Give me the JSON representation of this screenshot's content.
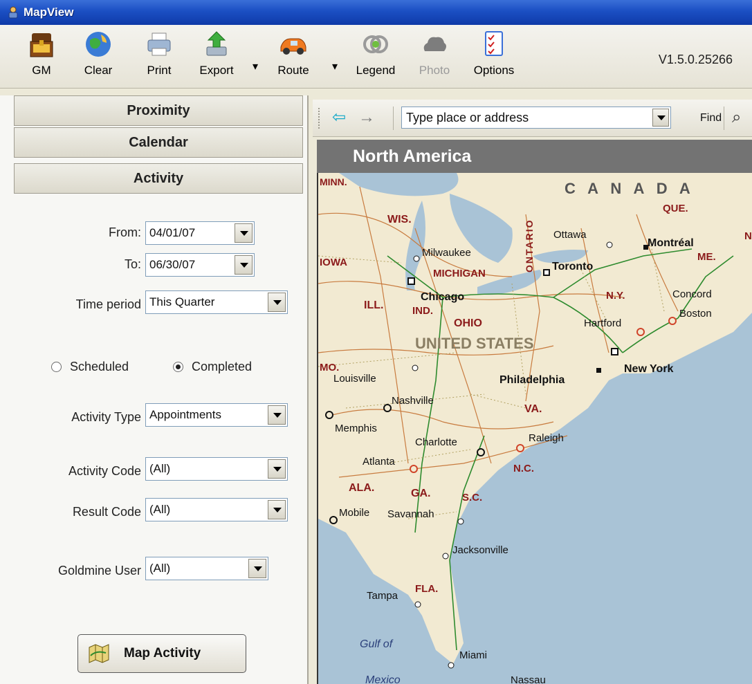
{
  "window": {
    "title": "MapView"
  },
  "toolbar": {
    "buttons": [
      {
        "label": "GM"
      },
      {
        "label": "Clear"
      },
      {
        "label": "Print"
      },
      {
        "label": "Export"
      },
      {
        "label": "Route"
      },
      {
        "label": "Legend"
      },
      {
        "label": "Photo"
      },
      {
        "label": "Options"
      }
    ],
    "dropdown_glyph": "▾",
    "version": "V1.5.0.25266"
  },
  "sidebar": {
    "sections": [
      {
        "label": "Proximity"
      },
      {
        "label": "Calendar"
      },
      {
        "label": "Activity"
      }
    ],
    "form": {
      "from_label": "From:",
      "from_value": "04/01/07",
      "to_label": "To:",
      "to_value": "06/30/07",
      "period_label": "Time period",
      "period_value": "This Quarter",
      "radio_scheduled": "Scheduled",
      "radio_completed": "Completed",
      "selected_radio": "Completed",
      "activity_type_label": "Activity Type",
      "activity_type_value": "Appointments",
      "activity_code_label": "Activity Code",
      "activity_code_value": "(All)",
      "result_code_label": "Result Code",
      "result_code_value": "(All)",
      "gm_user_label": "Goldmine User",
      "gm_user_value": "(All)"
    },
    "map_button": "Map Activity"
  },
  "navbar": {
    "back_glyph": "⇦",
    "forward_glyph": "→",
    "address_placeholder": "Type place or address",
    "find_label": "Find",
    "zoom_glyph": "⌕"
  },
  "map": {
    "region_title": "North America",
    "labels": {
      "canada": "C A N A D A",
      "que": "QUE.",
      "minn": "MINN.",
      "wis": "WIS.",
      "ontario": "ONTARIO",
      "iowa": "IOWA",
      "michigan": "MICHIGAN",
      "ill": "ILL.",
      "ind": "IND.",
      "ohio": "OHIO",
      "ny": "N.Y.",
      "me": "ME.",
      "us": "UNITED STATES",
      "mo": "MO.",
      "va": "VA.",
      "nc": "N.C.",
      "ala": "ALA.",
      "ga": "GA.",
      "sc": "S.C.",
      "fla": "FLA.",
      "n_edge": "N"
    },
    "cities": {
      "ottawa": "Ottawa",
      "montreal": "Montréal",
      "milwaukee": "Milwaukee",
      "toronto": "Toronto",
      "chicago": "Chicago",
      "concord": "Concord",
      "boston": "Boston",
      "hartford": "Hartford",
      "newyork": "New York",
      "louisville": "Louisville",
      "philadelphia": "Philadelphia",
      "nashville": "Nashville",
      "memphis": "Memphis",
      "charlotte": "Charlotte",
      "raleigh": "Raleigh",
      "atlanta": "Atlanta",
      "mobile": "Mobile",
      "savannah": "Savannah",
      "jacksonville": "Jacksonville",
      "tampa": "Tampa",
      "miami": "Miami",
      "nassau": "Nassau"
    },
    "water": {
      "gulf1": "Gulf of",
      "gulf2": "Mexico"
    },
    "colors": {
      "land": "#f2ead2",
      "water": "#a9c3d6",
      "state_label": "#8b1a1a",
      "road": "#c87b3f",
      "highway": "#2e8b2e"
    }
  }
}
